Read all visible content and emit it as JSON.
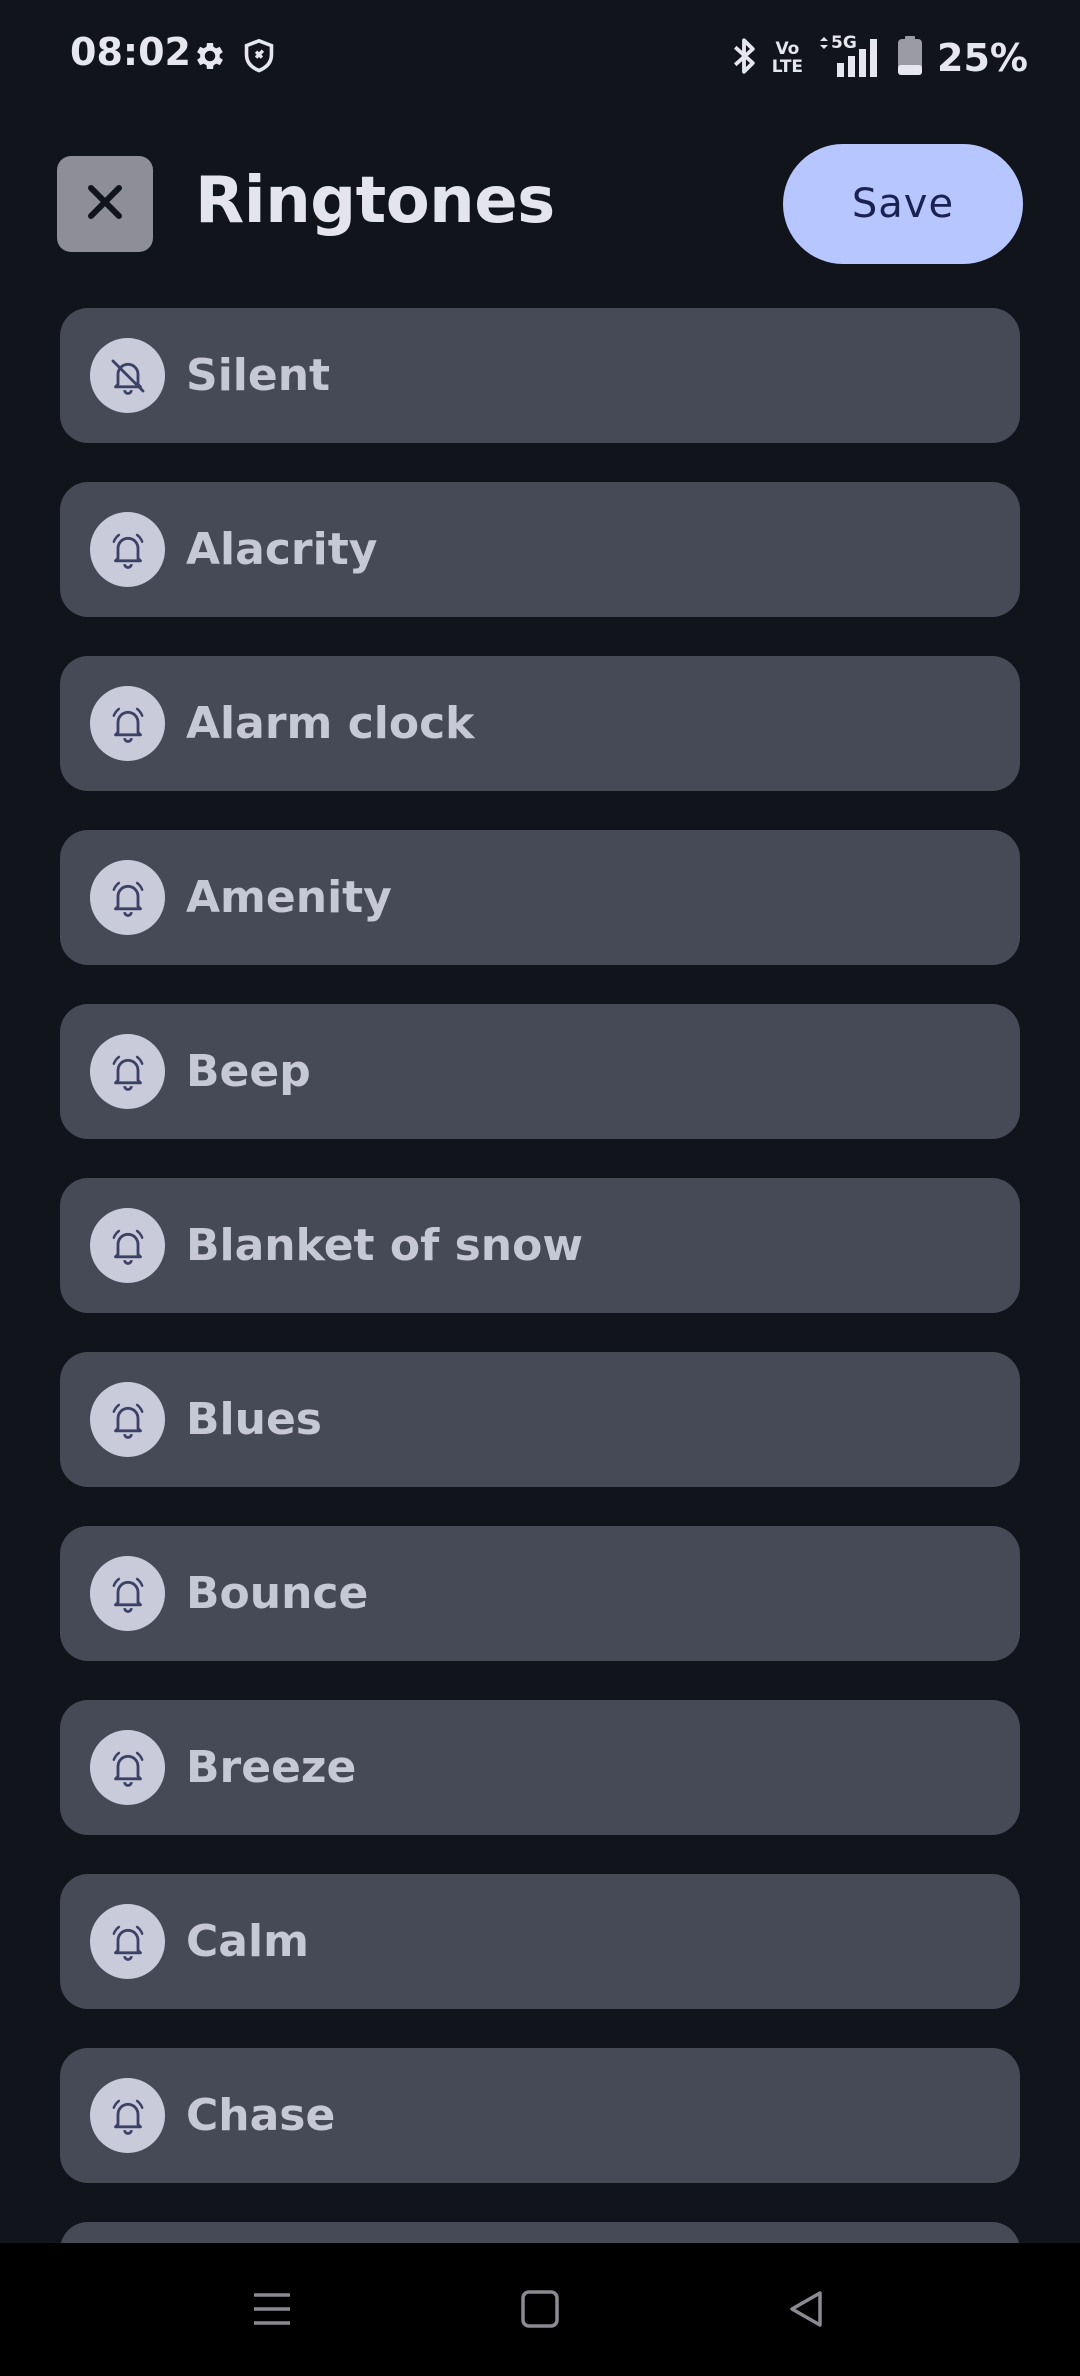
{
  "status_bar": {
    "time": "08:02",
    "icons": [
      "gear-icon",
      "shield-icon"
    ],
    "right_icons": [
      "bluetooth-icon",
      "volte-icon",
      "signal-5g-icon",
      "battery-icon"
    ],
    "volte_top": "Vo",
    "volte_bottom": "LTE",
    "network": "5G",
    "battery_percent": "25%",
    "battery_level": 0.25
  },
  "header": {
    "title": "Ringtones",
    "save_label": "Save",
    "close_icon": "close-icon"
  },
  "ringtones": [
    {
      "label": "Silent",
      "icon": "bell-off-icon"
    },
    {
      "label": "Alacrity",
      "icon": "bell-icon"
    },
    {
      "label": "Alarm clock",
      "icon": "bell-icon"
    },
    {
      "label": "Amenity",
      "icon": "bell-icon"
    },
    {
      "label": "Beep",
      "icon": "bell-icon"
    },
    {
      "label": "Blanket of snow",
      "icon": "bell-icon"
    },
    {
      "label": "Blues",
      "icon": "bell-icon"
    },
    {
      "label": "Bounce",
      "icon": "bell-icon"
    },
    {
      "label": "Breeze",
      "icon": "bell-icon"
    },
    {
      "label": "Calm",
      "icon": "bell-icon"
    },
    {
      "label": "Chase",
      "icon": "bell-icon"
    },
    {
      "label": "",
      "icon": "bell-icon"
    }
  ],
  "nav_bar": {
    "buttons": [
      "menu-icon",
      "home-icon",
      "back-icon"
    ]
  },
  "colors": {
    "background": "#12141b",
    "item_background": "#464956",
    "accent": "#b8c6ff",
    "item_text": "#c6c8d6"
  }
}
